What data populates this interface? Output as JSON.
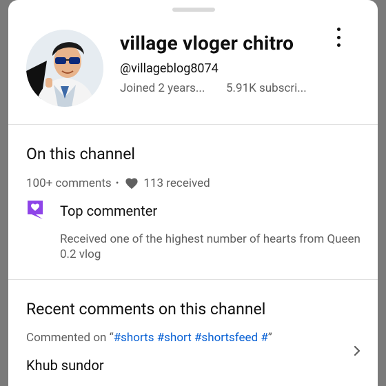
{
  "channel": {
    "name": "village vloger chitro",
    "handle": "@villageblog8074",
    "joined": "Joined 2 years...",
    "subscribers": "5.91K subscri..."
  },
  "on_channel": {
    "title": "On this channel",
    "comments": "100+ comments",
    "separator": "•",
    "hearts": "113 received",
    "badge_title": "Top commenter",
    "badge_description": "Received one of the highest number of hearts from Queen 0.2 vlog"
  },
  "recent": {
    "title": "Recent comments on this channel",
    "commented_on_prefix": "Commented on ",
    "open_quote": "“",
    "video_title": "#shorts #short #shortsfeed #",
    "close_quote": "”",
    "comment_text": "Khub sundor"
  },
  "colors": {
    "badge": "#8e44e8",
    "link": "#065fd4",
    "secondary_text": "#606060"
  },
  "icons": [
    "more-vert-icon",
    "heart-icon",
    "top-commenter-badge-icon",
    "chevron-right-icon"
  ]
}
